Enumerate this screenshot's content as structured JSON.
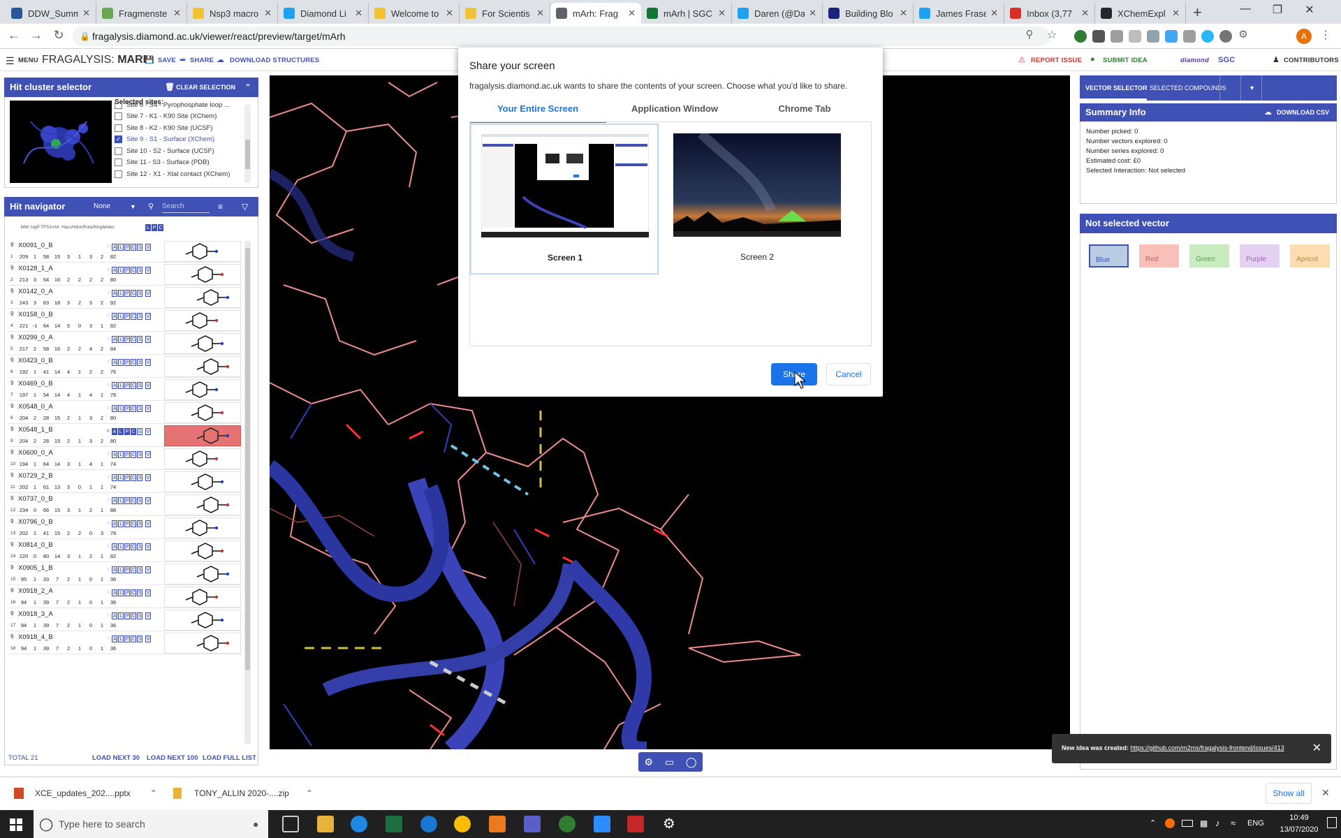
{
  "browser": {
    "tabs": [
      {
        "label": "DDW_Summ",
        "color": "#2b579a"
      },
      {
        "label": "Fragmenste",
        "color": "#6aa84f"
      },
      {
        "label": "Nsp3 macro",
        "color": "#f1c232"
      },
      {
        "label": "Diamond Li",
        "color": "#1da1f2"
      },
      {
        "label": "Welcome to",
        "color": "#f1c232"
      },
      {
        "label": "For Scientis",
        "color": "#f1c232"
      },
      {
        "label": "mArh: Frag",
        "color": "#5f6368"
      },
      {
        "label": "mArh | SGC",
        "color": "#137333"
      },
      {
        "label": "Daren (@Da",
        "color": "#1da1f2"
      },
      {
        "label": "Building Blo",
        "color": "#1a237e"
      },
      {
        "label": "James Frase",
        "color": "#1da1f2"
      },
      {
        "label": "Inbox (3,77",
        "color": "#d93025"
      },
      {
        "label": "XChemExpl",
        "color": "#24292e"
      }
    ],
    "active_tab_index": 6,
    "url": "fragalysis.diamond.ac.uk/viewer/react/preview/target/mArh",
    "profile_initial": "A"
  },
  "app": {
    "menu_label": "MENU",
    "title_prefix": "FRAGALYSIS: ",
    "title_target": "MARH",
    "save_label": "SAVE",
    "share_label": "SHARE",
    "download_label": "DOWNLOAD STRUCTURES",
    "report_issue_label": "REPORT ISSUE",
    "submit_idea_label": "SUBMIT IDEA",
    "contributors_label": "CONTRIBUTORS",
    "logos": [
      "diamond",
      "SGC"
    ]
  },
  "hit_cluster": {
    "title": "Hit cluster selector",
    "clear_label": "CLEAR SELECTION",
    "selected_sites_label": "Selected sites:",
    "sites": [
      {
        "label": "Site 6 - S4 - Pyrophosphate loop ...",
        "checked": false
      },
      {
        "label": "Site 7 - K1 - K90 Site (XChem)",
        "checked": false
      },
      {
        "label": "Site 8 - K2 - K90 Site (UCSF)",
        "checked": false
      },
      {
        "label": "Site 9 - S1 - Surface (XChem)",
        "checked": true
      },
      {
        "label": "Site 10 - S2 - Surface (UCSF)",
        "checked": false
      },
      {
        "label": "Site 11 - S3 - Surface (PDB)",
        "checked": false
      },
      {
        "label": "Site 12 - X1 - Xtal contact (XChem)",
        "checked": false
      }
    ]
  },
  "hit_nav": {
    "title": "Hit navigator",
    "filter_value": "None",
    "search_placeholder": "Search",
    "columns": [
      "MW",
      "logP",
      "TPSA",
      "HA",
      "Hacc",
      "Hdon",
      "Rota",
      "Rings",
      "Velec"
    ],
    "rows": [
      {
        "n": "9",
        "m": "1",
        "name": "X0091_0_B",
        "vals": [
          "209",
          "1",
          "58",
          "15",
          "3",
          "1",
          "3",
          "2",
          "82"
        ],
        "sel": false
      },
      {
        "n": "9",
        "m": "2",
        "name": "X0128_1_A",
        "vals": [
          "213",
          "3",
          "54",
          "16",
          "2",
          "2",
          "2",
          "2",
          "80"
        ],
        "sel": false
      },
      {
        "n": "9",
        "m": "3",
        "name": "X0142_0_A",
        "vals": [
          "243",
          "3",
          "63",
          "18",
          "3",
          "2",
          "3",
          "2",
          "92"
        ],
        "sel": false
      },
      {
        "n": "9",
        "m": "4",
        "name": "X0158_0_B",
        "vals": [
          "221",
          "-1",
          "64",
          "14",
          "5",
          "0",
          "3",
          "1",
          "82"
        ],
        "sel": false
      },
      {
        "n": "9",
        "m": "5",
        "name": "X0299_0_A",
        "vals": [
          "217",
          "2",
          "58",
          "16",
          "2",
          "2",
          "4",
          "2",
          "84"
        ],
        "sel": false
      },
      {
        "n": "9",
        "m": "6",
        "name": "X0423_0_B",
        "vals": [
          "192",
          "1",
          "41",
          "14",
          "4",
          "1",
          "2",
          "2",
          "76"
        ],
        "sel": false
      },
      {
        "n": "9",
        "m": "7",
        "name": "X0469_0_B",
        "vals": [
          "197",
          "1",
          "54",
          "14",
          "4",
          "1",
          "4",
          "1",
          "78"
        ],
        "sel": false
      },
      {
        "n": "9",
        "m": "8",
        "name": "X0548_0_A",
        "vals": [
          "204",
          "2",
          "28",
          "15",
          "2",
          "1",
          "3",
          "2",
          "80"
        ],
        "sel": false
      },
      {
        "n": "9",
        "m": "9",
        "name": "X0548_1_B",
        "vals": [
          "204",
          "2",
          "28",
          "15",
          "2",
          "1",
          "3",
          "2",
          "80"
        ],
        "sel": true
      },
      {
        "n": "9",
        "m": "10",
        "name": "X0600_0_A",
        "vals": [
          "194",
          "1",
          "64",
          "14",
          "3",
          "1",
          "4",
          "1",
          "74"
        ],
        "sel": false
      },
      {
        "n": "9",
        "m": "11",
        "name": "X0729_2_B",
        "vals": [
          "202",
          "1",
          "61",
          "13",
          "3",
          "0",
          "1",
          "1",
          "74"
        ],
        "sel": false
      },
      {
        "n": "9",
        "m": "12",
        "name": "X0737_0_B",
        "vals": [
          "234",
          "0",
          "66",
          "15",
          "3",
          "1",
          "2",
          "1",
          "88"
        ],
        "sel": false
      },
      {
        "n": "9",
        "m": "13",
        "name": "X0796_0_B",
        "vals": [
          "202",
          "1",
          "41",
          "15",
          "2",
          "2",
          "0",
          "3",
          "78"
        ],
        "sel": false
      },
      {
        "n": "9",
        "m": "14",
        "name": "X0814_0_B",
        "vals": [
          "220",
          "0",
          "80",
          "14",
          "3",
          "1",
          "2",
          "1",
          "82"
        ],
        "sel": false
      },
      {
        "n": "9",
        "m": "15",
        "name": "X0905_1_B",
        "vals": [
          "95",
          "1",
          "33",
          "7",
          "2",
          "1",
          "0",
          "1",
          "36"
        ],
        "sel": false
      },
      {
        "n": "9",
        "m": "16",
        "name": "X0918_2_A",
        "vals": [
          "94",
          "1",
          "39",
          "7",
          "2",
          "1",
          "0",
          "1",
          "36"
        ],
        "sel": false
      },
      {
        "n": "9",
        "m": "17",
        "name": "X0918_3_A",
        "vals": [
          "94",
          "1",
          "39",
          "7",
          "2",
          "1",
          "0",
          "1",
          "36"
        ],
        "sel": false
      },
      {
        "n": "9",
        "m": "18",
        "name": "X0918_4_B",
        "vals": [
          "94",
          "1",
          "39",
          "7",
          "2",
          "1",
          "0",
          "1",
          "36"
        ],
        "sel": false
      }
    ],
    "total_label": "TOTAL 21",
    "load_next_30": "LOAD NEXT 30",
    "load_next_100": "LOAD NEXT 100",
    "load_full": "LOAD FULL LIST"
  },
  "right": {
    "tab_vector": "VECTOR SELECTOR",
    "tab_compounds": "SELECTED COMPOUNDS",
    "summary_title": "Summary Info",
    "download_csv": "DOWNLOAD CSV",
    "summary_lines": [
      "Number picked: 0",
      "Number vectors explored: 0",
      "Number series explored: 0",
      "Estimated cost: £0",
      "Selected Interaction: Not selected"
    ],
    "nsv_title": "Not selected vector",
    "swatches": [
      {
        "label": "Blue",
        "bg": "#b8cce4",
        "fg": "#3f51b5",
        "sel": true
      },
      {
        "label": "Red",
        "bg": "#f8c0b8",
        "fg": "#c06060",
        "sel": false
      },
      {
        "label": "Green",
        "bg": "#c8ecc0",
        "fg": "#5a9a50",
        "sel": false
      },
      {
        "label": "Purple",
        "bg": "#e4d0f0",
        "fg": "#9a6ab0",
        "sel": false
      },
      {
        "label": "Apricot",
        "bg": "#fcdcb0",
        "fg": "#c08a40",
        "sel": false
      }
    ]
  },
  "dialog": {
    "title": "Share your screen",
    "subtitle": "fragalysis.diamond.ac.uk wants to share the contents of your screen. Choose what you'd like to share.",
    "tabs": [
      "Your Entire Screen",
      "Application Window",
      "Chrome Tab"
    ],
    "screens": [
      "Screen 1",
      "Screen 2"
    ],
    "share_label": "Share",
    "cancel_label": "Cancel"
  },
  "snackbar": {
    "text": "New idea was created: ",
    "link": "https://github.com/m2ms/fragalysis-frontend/issues/413"
  },
  "downloads": {
    "items": [
      "XCE_updates_202....pptx",
      "TONY_ALLIN 2020-....zip"
    ],
    "show_all": "Show all"
  },
  "taskbar": {
    "search_placeholder": "Type here to search",
    "lang": "ENG",
    "time": "10:49",
    "date": "13/07/2020"
  },
  "colors": {
    "primary": "#3f51b5",
    "chrome_blue": "#1a73e8",
    "selected_row": "#e57373"
  }
}
